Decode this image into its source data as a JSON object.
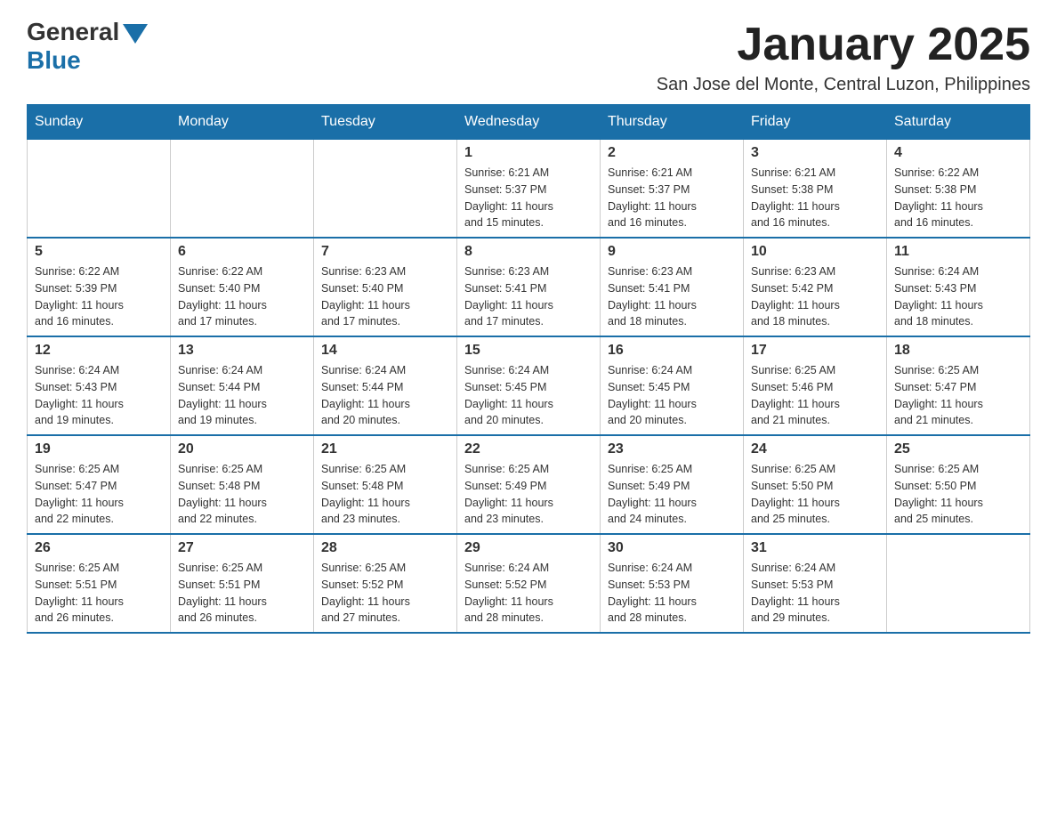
{
  "logo": {
    "general_text": "General",
    "blue_text": "Blue"
  },
  "title": "January 2025",
  "subtitle": "San Jose del Monte, Central Luzon, Philippines",
  "days_of_week": [
    "Sunday",
    "Monday",
    "Tuesday",
    "Wednesday",
    "Thursday",
    "Friday",
    "Saturday"
  ],
  "weeks": [
    [
      {
        "day": "",
        "info": ""
      },
      {
        "day": "",
        "info": ""
      },
      {
        "day": "",
        "info": ""
      },
      {
        "day": "1",
        "info": "Sunrise: 6:21 AM\nSunset: 5:37 PM\nDaylight: 11 hours\nand 15 minutes."
      },
      {
        "day": "2",
        "info": "Sunrise: 6:21 AM\nSunset: 5:37 PM\nDaylight: 11 hours\nand 16 minutes."
      },
      {
        "day": "3",
        "info": "Sunrise: 6:21 AM\nSunset: 5:38 PM\nDaylight: 11 hours\nand 16 minutes."
      },
      {
        "day": "4",
        "info": "Sunrise: 6:22 AM\nSunset: 5:38 PM\nDaylight: 11 hours\nand 16 minutes."
      }
    ],
    [
      {
        "day": "5",
        "info": "Sunrise: 6:22 AM\nSunset: 5:39 PM\nDaylight: 11 hours\nand 16 minutes."
      },
      {
        "day": "6",
        "info": "Sunrise: 6:22 AM\nSunset: 5:40 PM\nDaylight: 11 hours\nand 17 minutes."
      },
      {
        "day": "7",
        "info": "Sunrise: 6:23 AM\nSunset: 5:40 PM\nDaylight: 11 hours\nand 17 minutes."
      },
      {
        "day": "8",
        "info": "Sunrise: 6:23 AM\nSunset: 5:41 PM\nDaylight: 11 hours\nand 17 minutes."
      },
      {
        "day": "9",
        "info": "Sunrise: 6:23 AM\nSunset: 5:41 PM\nDaylight: 11 hours\nand 18 minutes."
      },
      {
        "day": "10",
        "info": "Sunrise: 6:23 AM\nSunset: 5:42 PM\nDaylight: 11 hours\nand 18 minutes."
      },
      {
        "day": "11",
        "info": "Sunrise: 6:24 AM\nSunset: 5:43 PM\nDaylight: 11 hours\nand 18 minutes."
      }
    ],
    [
      {
        "day": "12",
        "info": "Sunrise: 6:24 AM\nSunset: 5:43 PM\nDaylight: 11 hours\nand 19 minutes."
      },
      {
        "day": "13",
        "info": "Sunrise: 6:24 AM\nSunset: 5:44 PM\nDaylight: 11 hours\nand 19 minutes."
      },
      {
        "day": "14",
        "info": "Sunrise: 6:24 AM\nSunset: 5:44 PM\nDaylight: 11 hours\nand 20 minutes."
      },
      {
        "day": "15",
        "info": "Sunrise: 6:24 AM\nSunset: 5:45 PM\nDaylight: 11 hours\nand 20 minutes."
      },
      {
        "day": "16",
        "info": "Sunrise: 6:24 AM\nSunset: 5:45 PM\nDaylight: 11 hours\nand 20 minutes."
      },
      {
        "day": "17",
        "info": "Sunrise: 6:25 AM\nSunset: 5:46 PM\nDaylight: 11 hours\nand 21 minutes."
      },
      {
        "day": "18",
        "info": "Sunrise: 6:25 AM\nSunset: 5:47 PM\nDaylight: 11 hours\nand 21 minutes."
      }
    ],
    [
      {
        "day": "19",
        "info": "Sunrise: 6:25 AM\nSunset: 5:47 PM\nDaylight: 11 hours\nand 22 minutes."
      },
      {
        "day": "20",
        "info": "Sunrise: 6:25 AM\nSunset: 5:48 PM\nDaylight: 11 hours\nand 22 minutes."
      },
      {
        "day": "21",
        "info": "Sunrise: 6:25 AM\nSunset: 5:48 PM\nDaylight: 11 hours\nand 23 minutes."
      },
      {
        "day": "22",
        "info": "Sunrise: 6:25 AM\nSunset: 5:49 PM\nDaylight: 11 hours\nand 23 minutes."
      },
      {
        "day": "23",
        "info": "Sunrise: 6:25 AM\nSunset: 5:49 PM\nDaylight: 11 hours\nand 24 minutes."
      },
      {
        "day": "24",
        "info": "Sunrise: 6:25 AM\nSunset: 5:50 PM\nDaylight: 11 hours\nand 25 minutes."
      },
      {
        "day": "25",
        "info": "Sunrise: 6:25 AM\nSunset: 5:50 PM\nDaylight: 11 hours\nand 25 minutes."
      }
    ],
    [
      {
        "day": "26",
        "info": "Sunrise: 6:25 AM\nSunset: 5:51 PM\nDaylight: 11 hours\nand 26 minutes."
      },
      {
        "day": "27",
        "info": "Sunrise: 6:25 AM\nSunset: 5:51 PM\nDaylight: 11 hours\nand 26 minutes."
      },
      {
        "day": "28",
        "info": "Sunrise: 6:25 AM\nSunset: 5:52 PM\nDaylight: 11 hours\nand 27 minutes."
      },
      {
        "day": "29",
        "info": "Sunrise: 6:24 AM\nSunset: 5:52 PM\nDaylight: 11 hours\nand 28 minutes."
      },
      {
        "day": "30",
        "info": "Sunrise: 6:24 AM\nSunset: 5:53 PM\nDaylight: 11 hours\nand 28 minutes."
      },
      {
        "day": "31",
        "info": "Sunrise: 6:24 AM\nSunset: 5:53 PM\nDaylight: 11 hours\nand 29 minutes."
      },
      {
        "day": "",
        "info": ""
      }
    ]
  ]
}
